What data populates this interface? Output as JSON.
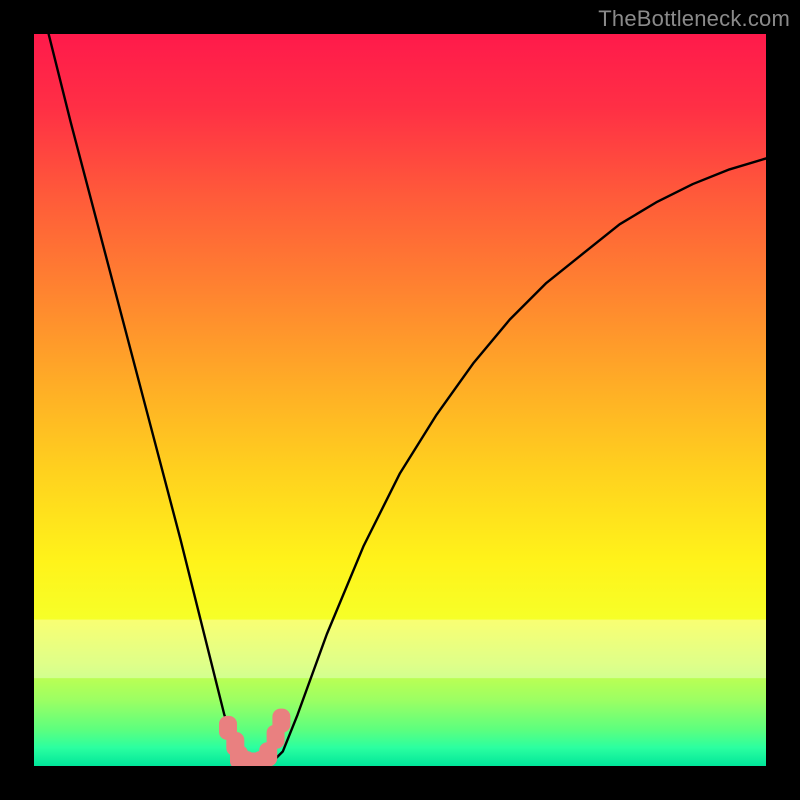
{
  "watermark": "TheBottleneck.com",
  "chart_data": {
    "type": "line",
    "title": "",
    "xlabel": "",
    "ylabel": "",
    "xlim": [
      0,
      100
    ],
    "ylim": [
      0,
      100
    ],
    "grid": false,
    "series": [
      {
        "name": "bottleneck-curve",
        "x": [
          0,
          5,
          10,
          15,
          20,
          24,
          26,
          28,
          30,
          32,
          34,
          36,
          40,
          45,
          50,
          55,
          60,
          65,
          70,
          75,
          80,
          85,
          90,
          95,
          100
        ],
        "y": [
          108,
          88,
          69,
          50,
          31,
          15,
          7,
          2,
          0,
          0,
          2,
          7,
          18,
          30,
          40,
          48,
          55,
          61,
          66,
          70,
          74,
          77,
          79.5,
          81.5,
          83
        ]
      }
    ],
    "markers": {
      "name": "highlight-points",
      "x": [
        26.5,
        27.5,
        28,
        29,
        30,
        31,
        32,
        33,
        33.8
      ],
      "y": [
        5.2,
        3.0,
        1.2,
        0.4,
        0.2,
        0.4,
        1.6,
        4.0,
        6.2
      ]
    },
    "background_gradient": {
      "stops": [
        {
          "offset": 0.0,
          "color": "#ff1a4b"
        },
        {
          "offset": 0.1,
          "color": "#ff2f45"
        },
        {
          "offset": 0.22,
          "color": "#ff5a3a"
        },
        {
          "offset": 0.35,
          "color": "#ff8330"
        },
        {
          "offset": 0.48,
          "color": "#ffad26"
        },
        {
          "offset": 0.6,
          "color": "#ffd21e"
        },
        {
          "offset": 0.72,
          "color": "#fff31a"
        },
        {
          "offset": 0.8,
          "color": "#f6ff28"
        },
        {
          "offset": 0.86,
          "color": "#ceff4a"
        },
        {
          "offset": 0.91,
          "color": "#9cff63"
        },
        {
          "offset": 0.95,
          "color": "#5dff7e"
        },
        {
          "offset": 0.975,
          "color": "#2bffa0"
        },
        {
          "offset": 1.0,
          "color": "#00e69a"
        }
      ]
    },
    "pale_band": {
      "y0": 80,
      "y1": 88,
      "opacity": 0.35
    }
  }
}
